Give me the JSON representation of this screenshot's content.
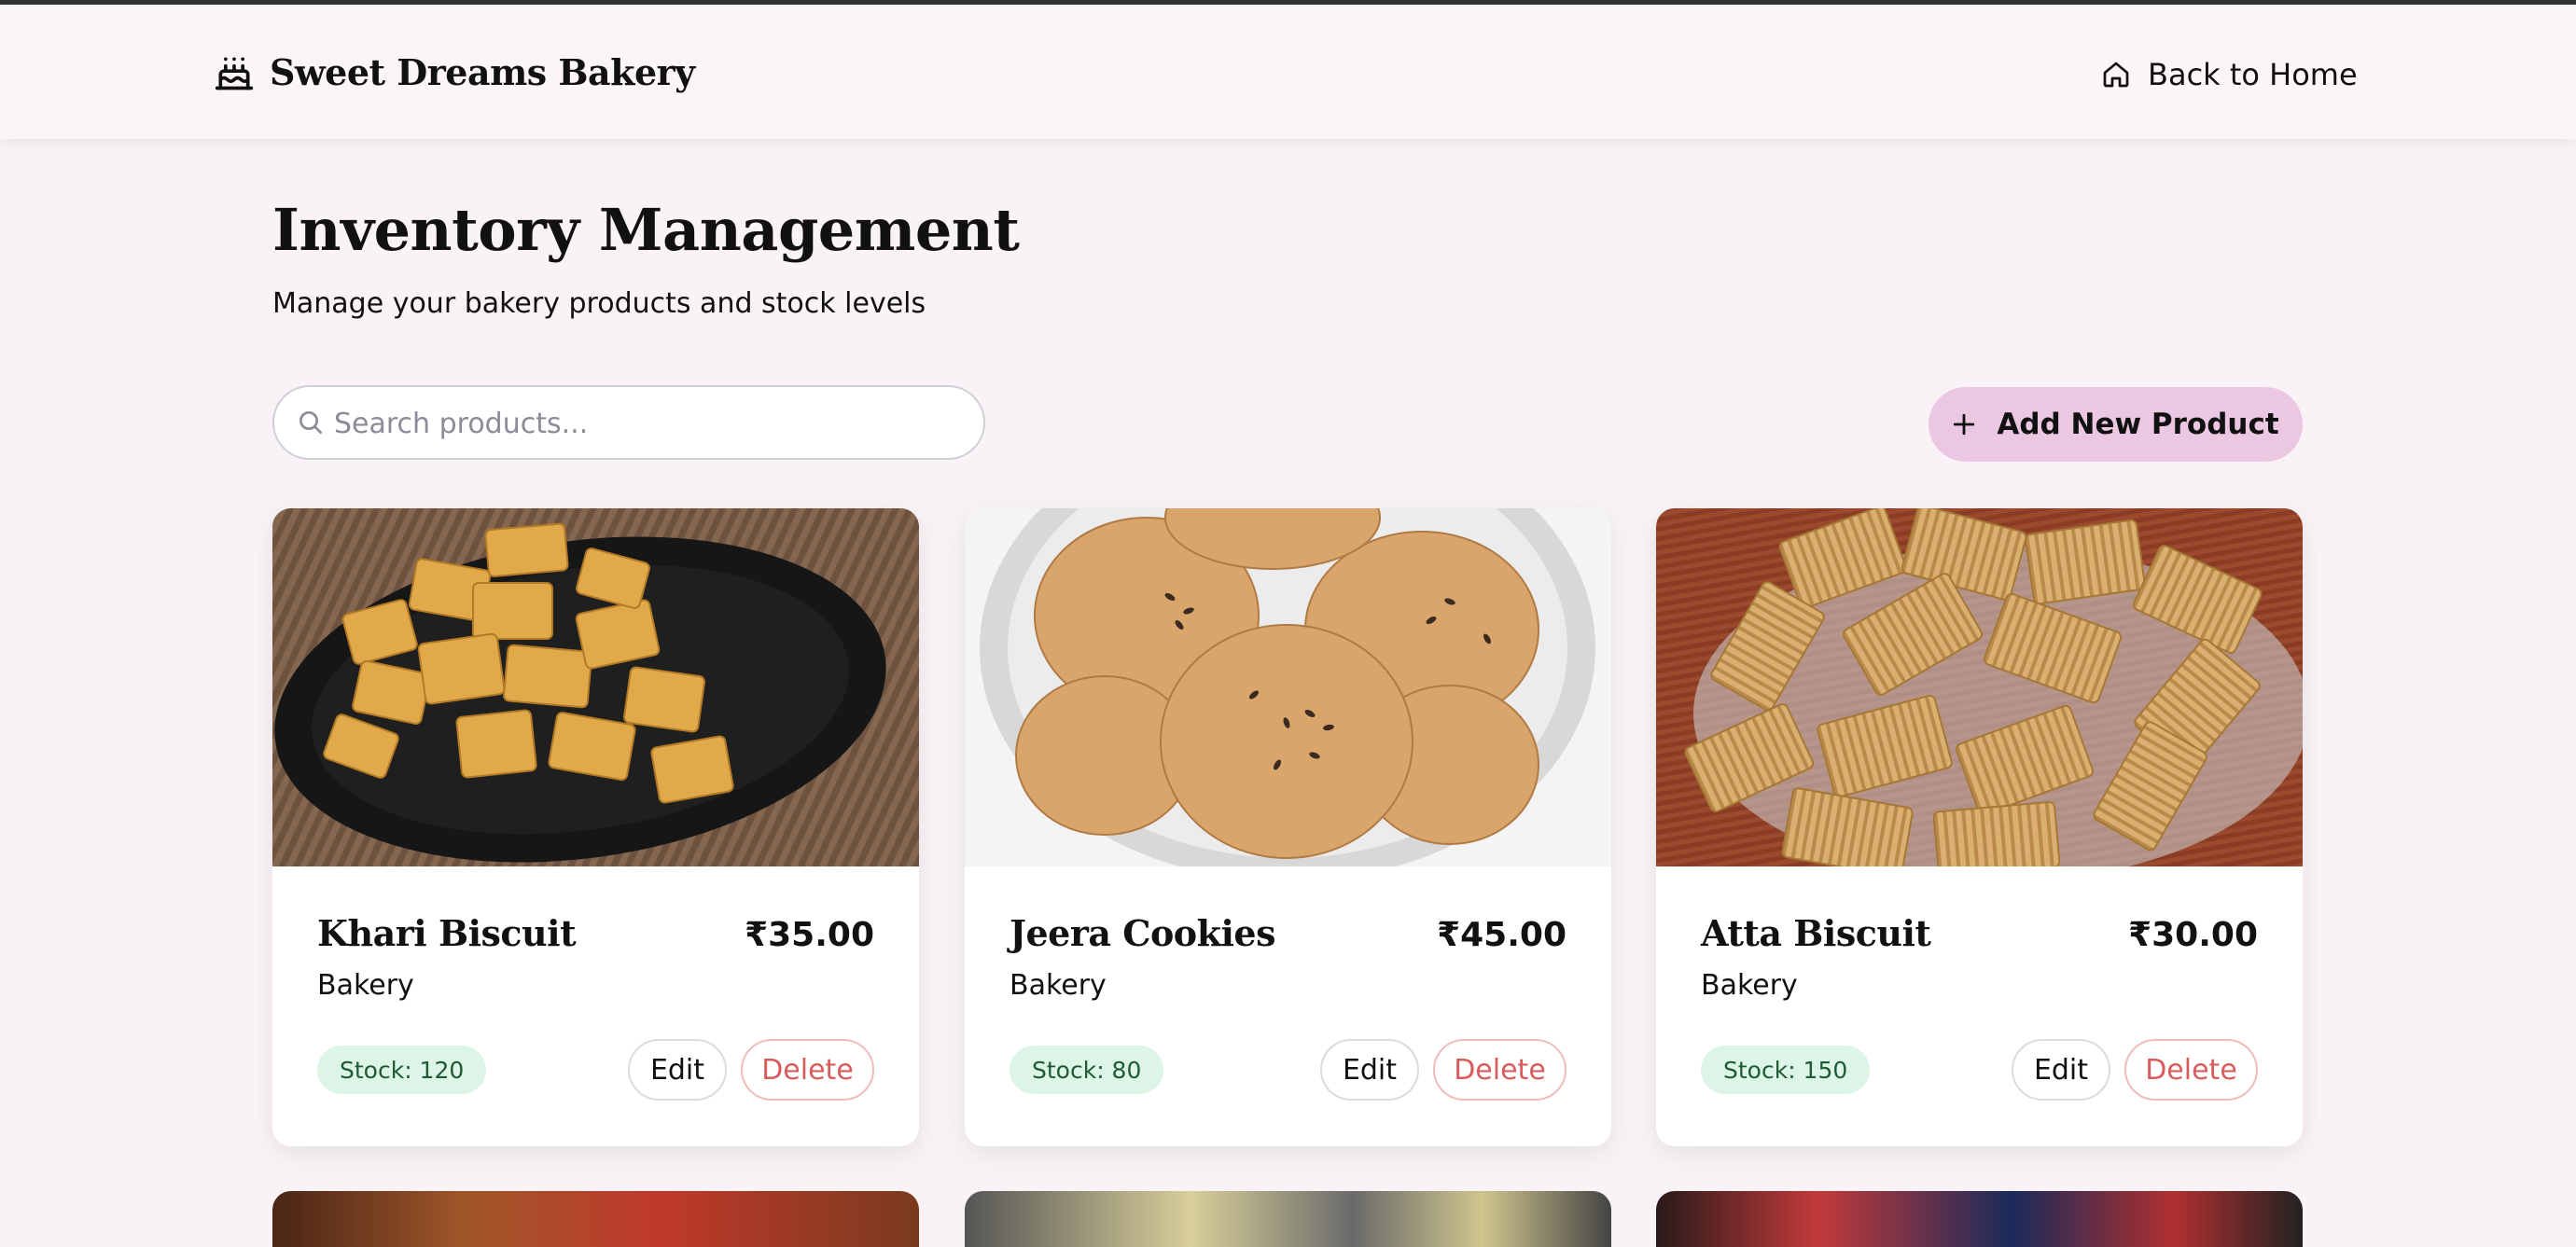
{
  "header": {
    "brand_icon": "cake-icon",
    "brand_name": "Sweet Dreams Bakery",
    "back_home_icon": "home-icon",
    "back_home_label": "Back to Home"
  },
  "page": {
    "title": "Inventory Management",
    "subtitle": "Manage your bakery products and stock levels"
  },
  "search": {
    "icon": "search-icon",
    "placeholder": "Search products...",
    "value": ""
  },
  "add_button": {
    "icon": "plus-icon",
    "label": "Add New Product"
  },
  "colors": {
    "page_background": "#f9f3f7",
    "accent_button": "#ecc7e2",
    "stock_badge_background": "#dcf5e6",
    "stock_badge_text": "#1e5a35",
    "delete_text": "#d95c5c"
  },
  "products": [
    {
      "name": "Khari Biscuit",
      "price": "₹35.00",
      "category": "Bakery",
      "stock_label": "Stock: 120",
      "edit_label": "Edit",
      "delete_label": "Delete"
    },
    {
      "name": "Jeera Cookies",
      "price": "₹45.00",
      "category": "Bakery",
      "stock_label": "Stock: 80",
      "edit_label": "Edit",
      "delete_label": "Delete"
    },
    {
      "name": "Atta Biscuit",
      "price": "₹30.00",
      "category": "Bakery",
      "stock_label": "Stock: 150",
      "edit_label": "Edit",
      "delete_label": "Delete"
    }
  ]
}
